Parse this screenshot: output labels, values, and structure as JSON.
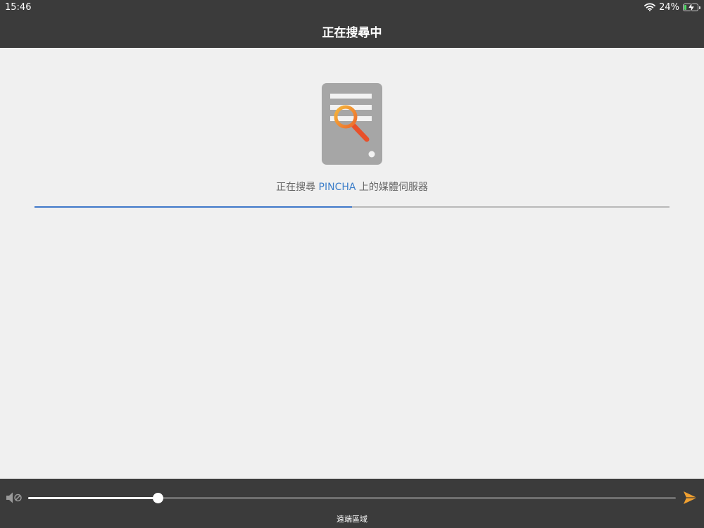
{
  "status_bar": {
    "time": "15:46",
    "battery_percent_text": "24%",
    "battery_level": 0.24,
    "icons": [
      "wifi-icon",
      "battery-charging-icon"
    ]
  },
  "nav": {
    "title": "正在搜尋中"
  },
  "search": {
    "icon": "document-search-icon",
    "text_prefix": "正在搜尋 ",
    "host": "PINCHA",
    "text_suffix": " 上的媒體伺服器",
    "progress": 0.5
  },
  "bottom_bar": {
    "mute_icon": "speaker-muted-icon",
    "volume_level": 0.2,
    "send_icon": "send-arrow-icon",
    "zone_label": "遠端區域"
  },
  "colors": {
    "header_bg": "#3b3b3b",
    "content_bg": "#f0f0f0",
    "accent_blue": "#3a7dc9",
    "send_orange": "#f0a030",
    "battery_green": "#4cd964"
  }
}
